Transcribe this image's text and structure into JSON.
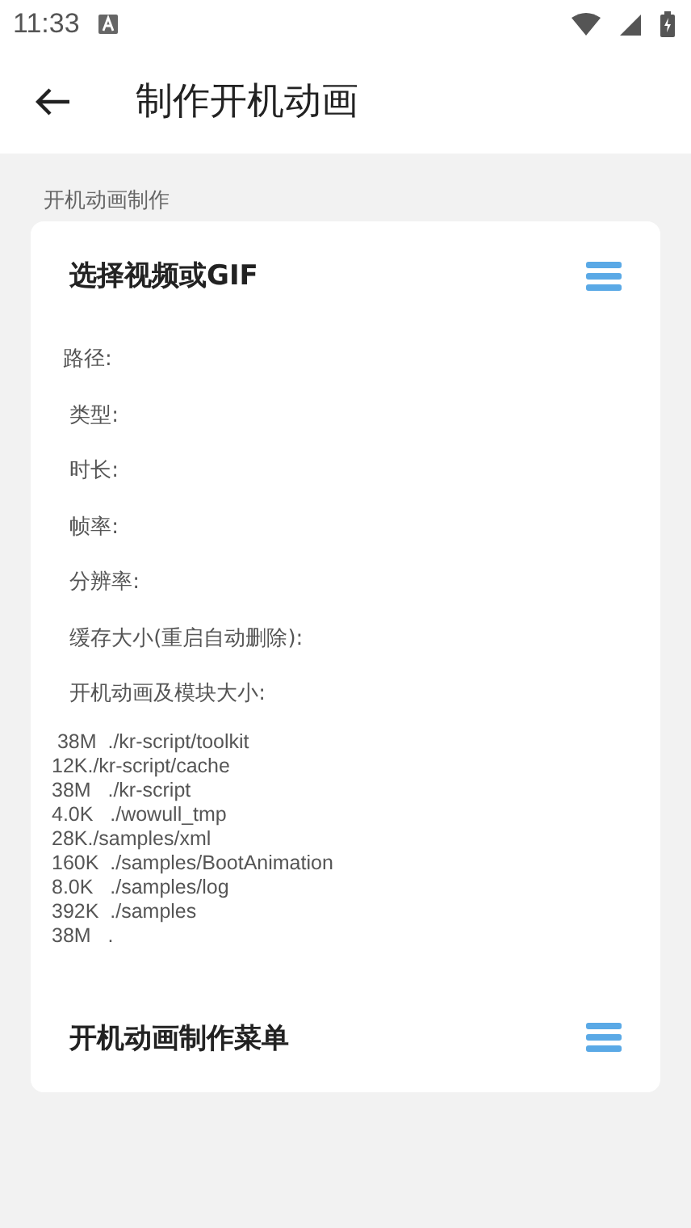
{
  "status_bar": {
    "time": "11:33"
  },
  "app_bar": {
    "title": "制作开机动画"
  },
  "section": {
    "label": "开机动画制作"
  },
  "card": {
    "title": "选择视频或GIF",
    "info": [
      "路径:",
      " 类型:",
      " 时长:",
      " 帧率:",
      " 分辨率:",
      " 缓存大小(重启自动删除):",
      " 开机动画及模块大小:"
    ],
    "output": [
      " 38M  ./kr-script/toolkit",
      "12K./kr-script/cache",
      "38M   ./kr-script",
      "4.0K   ./wowull_tmp",
      "28K./samples/xml",
      "160K  ./samples/BootAnimation",
      "8.0K   ./samples/log",
      "392K  ./samples",
      "38M   ."
    ],
    "menu_title": "开机动画制作菜单"
  }
}
